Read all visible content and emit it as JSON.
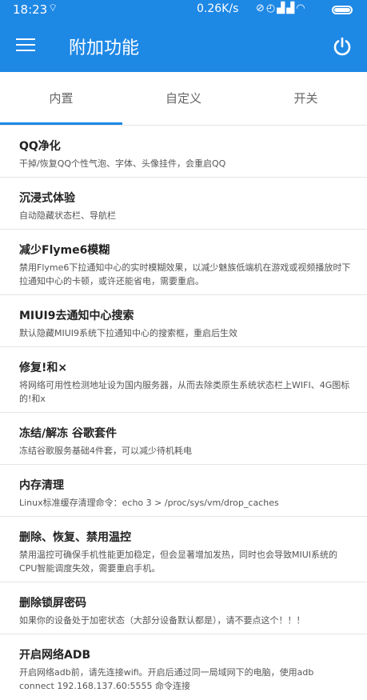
{
  "status_bar": {
    "time": "18:23",
    "net_speed": "0.26K/s",
    "icons": [
      "cast-icon",
      "mute-icon",
      "alarm-icon",
      "signal-icon",
      "signal-icon",
      "wifi-icon",
      "battery-icon"
    ]
  },
  "app_bar": {
    "title": "附加功能",
    "color": "#1e88e5"
  },
  "tabs": [
    {
      "label": "内置",
      "selected": true
    },
    {
      "label": "自定义",
      "selected": false
    },
    {
      "label": "开关",
      "selected": false
    }
  ],
  "items": [
    {
      "title": "QQ净化",
      "desc": "干掉/恢复QQ个性气泡、字体、头像挂件，会重启QQ"
    },
    {
      "title": "沉浸式体验",
      "desc": "自动隐藏状态栏、导航栏"
    },
    {
      "title": "减少Flyme6模糊",
      "desc": "禁用Flyme6下拉通知中心的实时模糊效果，以减少魅族低端机在游戏或视频播放时下拉通知中心的卡顿，或许还能省电，需要重启。"
    },
    {
      "title": "MIUI9去通知中心搜索",
      "desc": "默认隐藏MIUI9系统下拉通知中心的搜索框，重启后生效"
    },
    {
      "title": "修复!和×",
      "desc": "将网络可用性检测地址设为国内服务器，从而去除类原生系统状态栏上WIFI、4G图标的!和x"
    },
    {
      "title": "冻结/解冻 谷歌套件",
      "desc": "冻结谷歌服务基础4件套，可以减少待机耗电"
    },
    {
      "title": "内存清理",
      "desc": "Linux标准缓存清理命令：echo 3 > /proc/sys/vm/drop_caches"
    },
    {
      "title": "删除、恢复、禁用温控",
      "desc": "禁用温控可确保手机性能更加稳定，但会显著增加发热，同时也会导致MIUI系统的CPU智能调度失效，需要重启手机。"
    },
    {
      "title": "删除锁屏密码",
      "desc": "如果你的设备处于加密状态（大部分设备默认都是），请不要点这个！！！"
    },
    {
      "title": "开启网络ADB",
      "desc": "开启网络adb前，请先连接wifi。开启后通过同一局域网下的电脑，使用adb connect 192.168.137.60:5555 命令连接"
    }
  ]
}
